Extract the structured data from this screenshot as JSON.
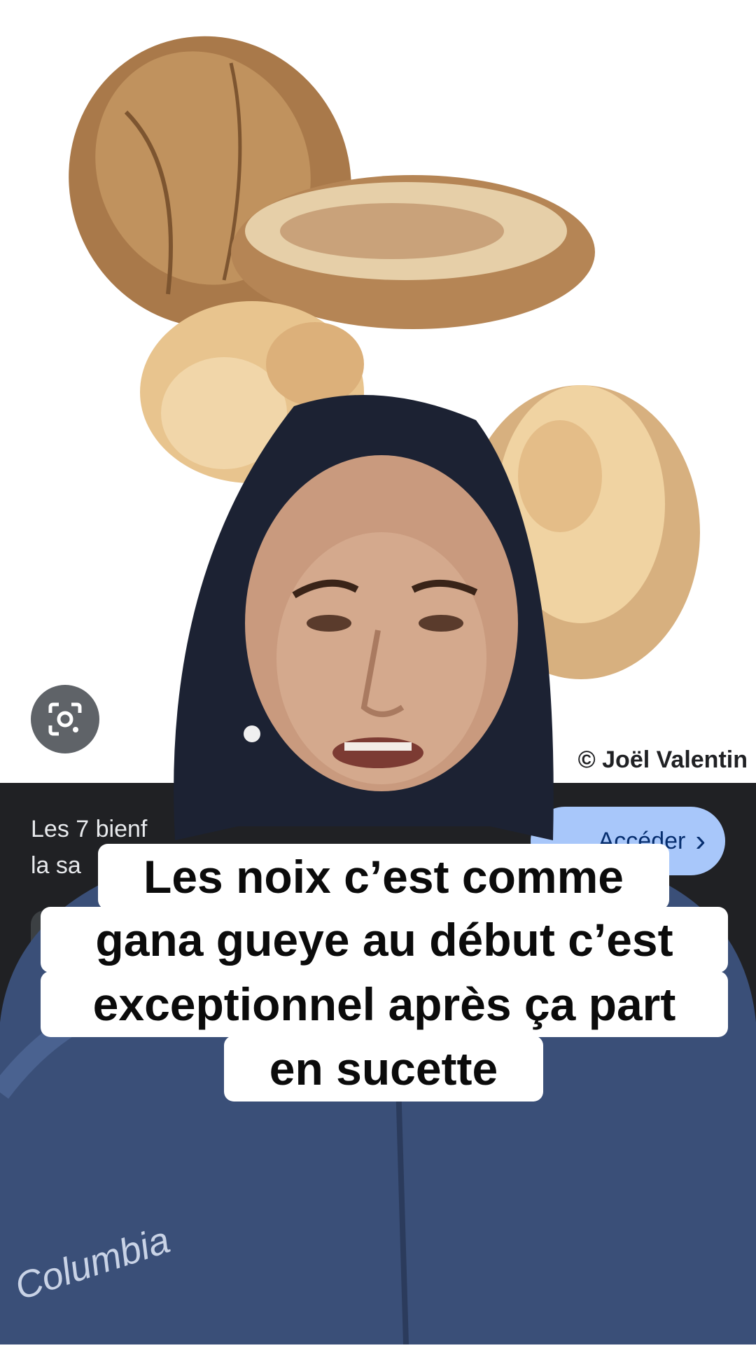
{
  "background": {
    "credit": "© Joël Valentin"
  },
  "search_result": {
    "title_line1": "Les 7 bienf",
    "title_line2": "la sa",
    "access_label": "Accéder",
    "access_chevron": "›"
  },
  "icons": {
    "lens": "google-lens-icon"
  },
  "caption": {
    "line1": "Les noix c’est comme",
    "line2": "gana gueye au début c’est",
    "line3": "exceptionnel après ça part",
    "line4": "en sucette"
  },
  "jacket": {
    "brand": "Columbia"
  },
  "colors": {
    "panel": "#202124",
    "access_button": "#a8c7fa",
    "jacket": "#3a4f78",
    "hood": "#1c2233",
    "walnut_shell": "#a9794a",
    "walnut_kernel": "#e8c48e"
  }
}
